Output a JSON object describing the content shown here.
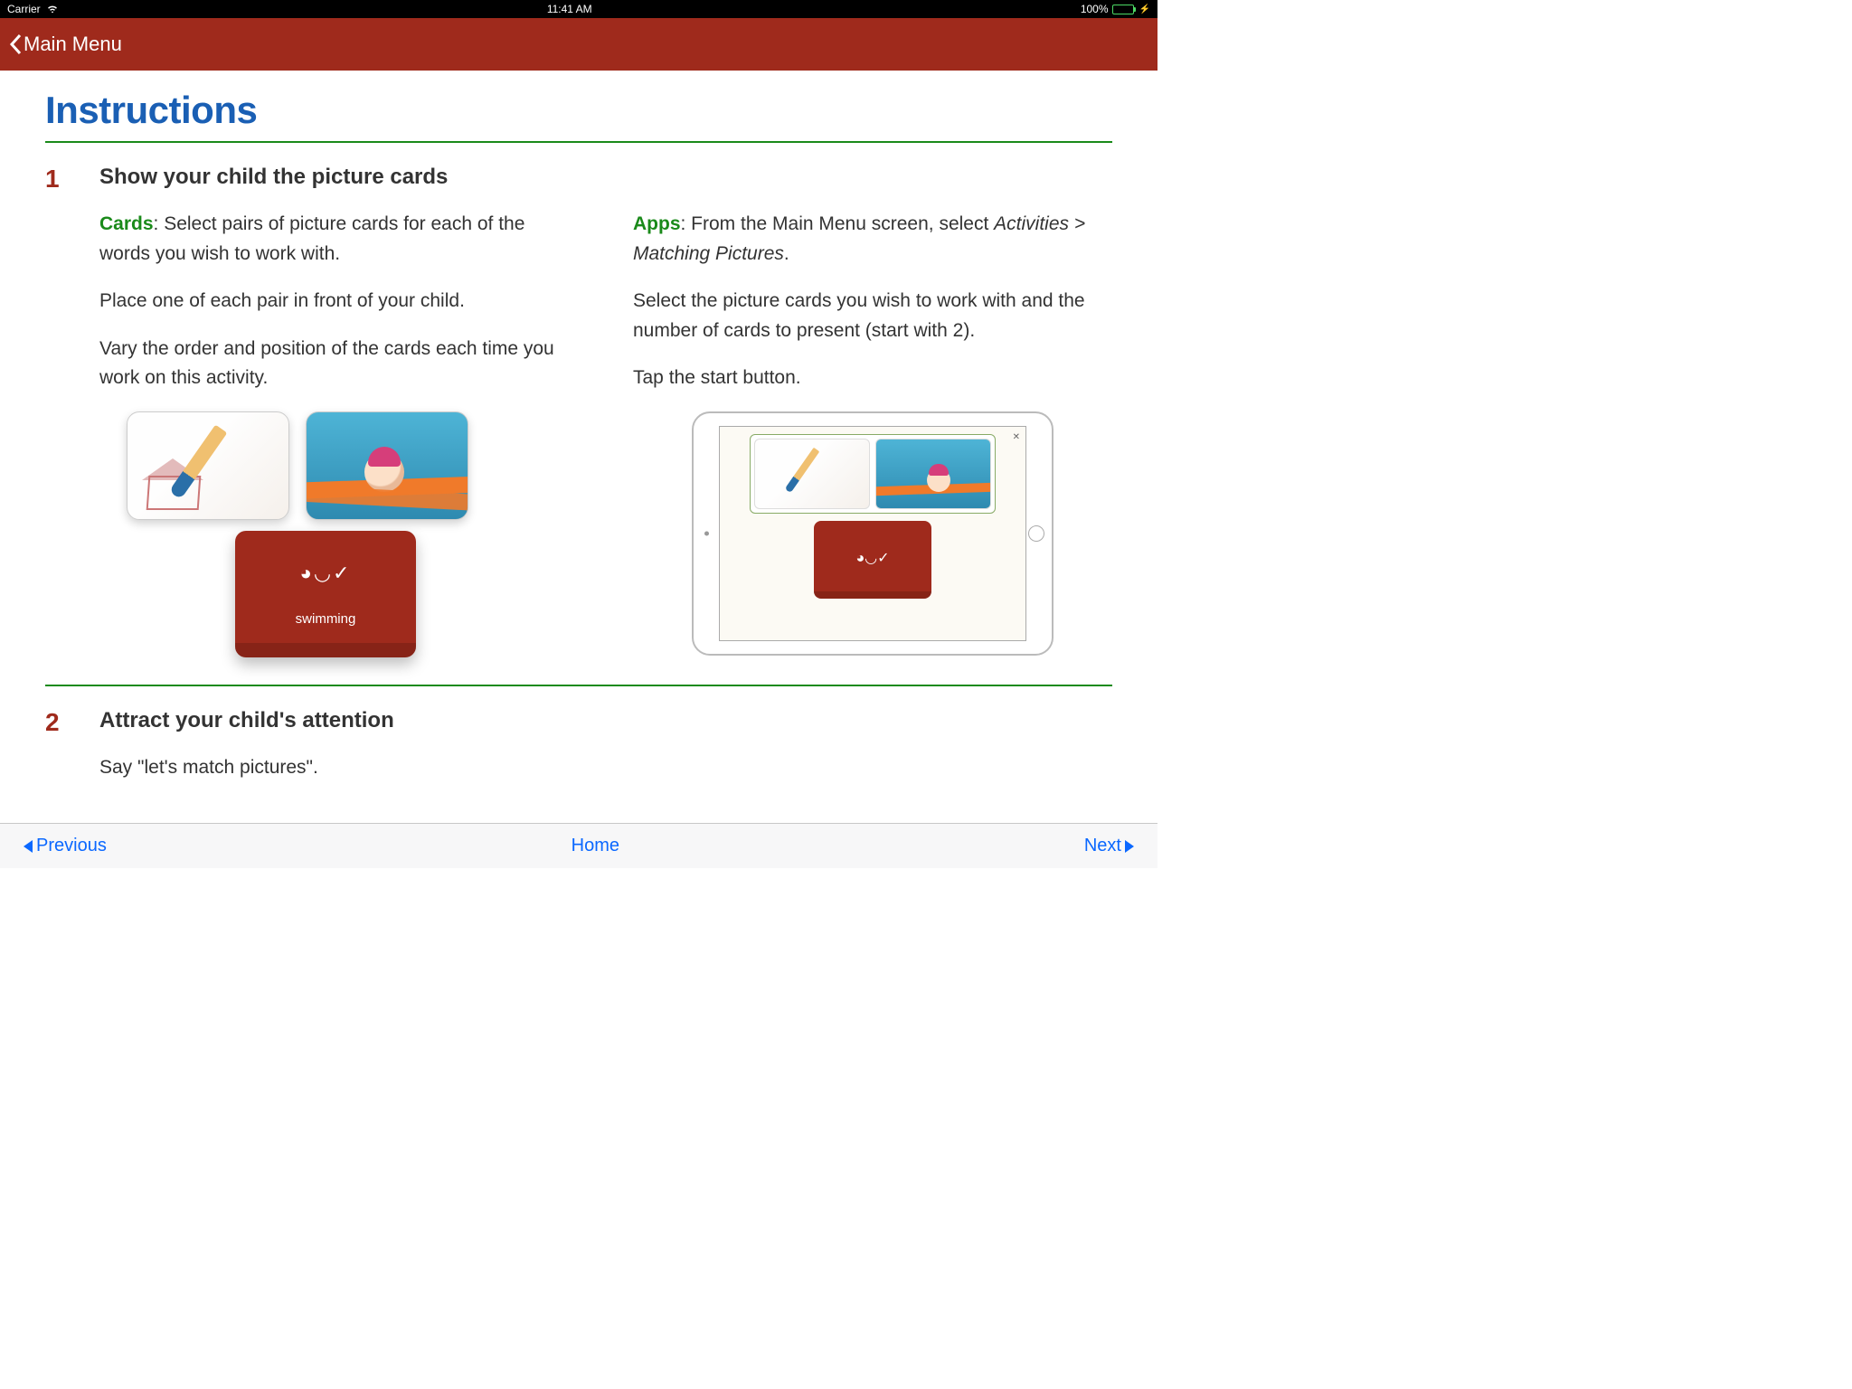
{
  "status": {
    "carrier": "Carrier",
    "time": "11:41 AM",
    "battery": "100%"
  },
  "nav": {
    "back_label": "Main Menu"
  },
  "page": {
    "title": "Instructions"
  },
  "steps": [
    {
      "num": "1",
      "heading": "Show your child the picture cards",
      "left": {
        "label": "Cards",
        "p1_rest": ": Select pairs of picture cards for each of the words you wish to work with.",
        "p2": "Place one of each pair in front of your child.",
        "p3": "Vary the order and position of the cards each time you work on this activity."
      },
      "right": {
        "label": "Apps",
        "p1_a": ": From the Main Menu screen, select ",
        "p1_italic": "Activities > Matching Pictures",
        "p1_b": ".",
        "p2": "Select the picture cards you wish to work with and the number of cards to present (start with 2).",
        "p3": "Tap the start button."
      },
      "red_card_label": "swimming"
    },
    {
      "num": "2",
      "heading": "Attract your child's attention",
      "p1": "Say \"let's match pictures\"."
    }
  ],
  "toolbar": {
    "prev": "Previous",
    "home": "Home",
    "next": "Next"
  },
  "smiley_glyph": "◕◡✓"
}
